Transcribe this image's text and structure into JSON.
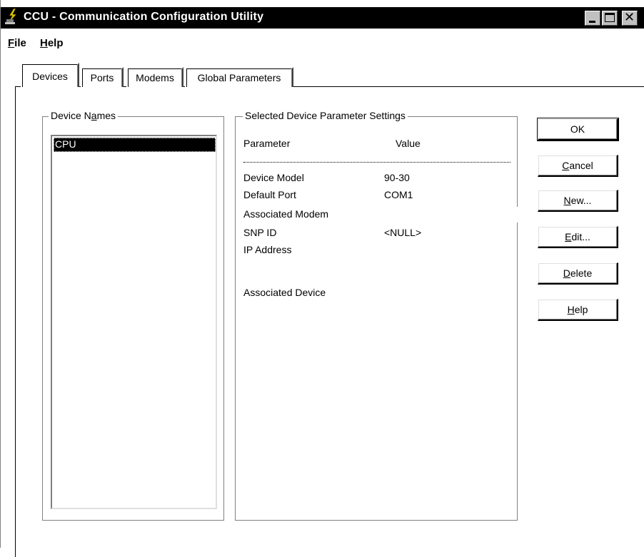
{
  "window": {
    "title": "CCU - Communication Configuration Utility"
  },
  "menu": {
    "file_u": "F",
    "file_rest": "ile",
    "help_u": "H",
    "help_rest": "elp"
  },
  "tabs": [
    {
      "label": "Devices",
      "active": true
    },
    {
      "label": "Ports"
    },
    {
      "label": "Modems"
    },
    {
      "label": "Global Parameters"
    }
  ],
  "device_names": {
    "legend_pre": "Device N",
    "legend_u": "a",
    "legend_post": "mes",
    "items": [
      "CPU"
    ],
    "selected": "CPU"
  },
  "params": {
    "legend": "Selected Device Parameter Settings",
    "header_param": "Parameter",
    "header_value": "Value",
    "rows": [
      {
        "name": "Device Model",
        "value": "90-30"
      },
      {
        "name": "Default Port",
        "value": "COM1"
      },
      {
        "name": "Associated Modem",
        "value": ""
      },
      {
        "name": "SNP ID",
        "value": "<NULL>"
      },
      {
        "name": "IP Address",
        "value": ""
      },
      {
        "name": "Associated Device",
        "value": ""
      }
    ]
  },
  "buttons": {
    "ok": "OK",
    "cancel_u": "C",
    "cancel_rest": "ancel",
    "new_u": "N",
    "new_rest": "ew...",
    "edit_u": "E",
    "edit_rest": "dit...",
    "delete_u": "D",
    "delete_rest": "elete",
    "help_u": "H",
    "help_rest": "elp"
  },
  "colors": {
    "titlebar": "#000000",
    "selection": "#000000",
    "face": "#ffffff"
  },
  "icons": {
    "app": "plug-lightning-icon",
    "minimize": "minimize-icon",
    "maximize": "maximize-icon",
    "close": "close-icon"
  }
}
